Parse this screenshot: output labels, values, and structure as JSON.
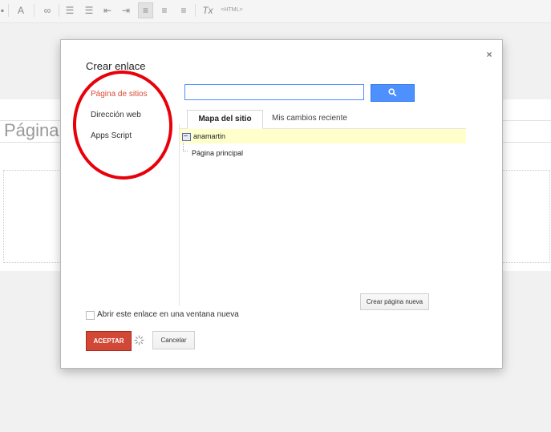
{
  "toolbar": {
    "items": [
      {
        "name": "text-color-icon",
        "glyph": "A"
      },
      {
        "name": "link-icon",
        "glyph": "∞"
      },
      {
        "name": "numbered-list-icon",
        "glyph": "☰"
      },
      {
        "name": "bullet-list-icon",
        "glyph": "☰"
      },
      {
        "name": "outdent-icon",
        "glyph": "⇤"
      },
      {
        "name": "indent-icon",
        "glyph": "⇥"
      },
      {
        "name": "align-left-icon",
        "glyph": "≡"
      },
      {
        "name": "align-center-icon",
        "glyph": "≡"
      },
      {
        "name": "align-right-icon",
        "glyph": "≡"
      },
      {
        "name": "clear-format-icon",
        "glyph": "Tx"
      }
    ],
    "html_label": "<HTML>"
  },
  "background": {
    "page_title": "Página p"
  },
  "dialog": {
    "title": "Crear enlace",
    "close_glyph": "×",
    "nav": [
      {
        "label": "Página de sitios",
        "selected": true
      },
      {
        "label": "Dirección web",
        "selected": false
      },
      {
        "label": "Apps Script",
        "selected": false
      }
    ],
    "search": {
      "value": "",
      "placeholder": ""
    },
    "tabs": [
      {
        "label": "Mapa del sitio",
        "active": true
      },
      {
        "label": "Mis cambios reciente",
        "active": false
      }
    ],
    "tree": [
      {
        "label": "anamartin",
        "highlighted": true
      },
      {
        "label": "Página principal",
        "highlighted": false
      }
    ],
    "create_page_label": "Crear página nueva",
    "open_new_window_label": "Abrir este enlace en una ventana nueva",
    "open_new_window_checked": false,
    "accept_label": "ACEPTAR",
    "cancel_label": "Cancelar"
  },
  "colors": {
    "accent_blue": "#4d90fe",
    "accept_red": "#d14836",
    "selected_nav": "#dd4b39",
    "highlight_row": "#ffffcc",
    "annotation_red": "#e8000a"
  }
}
